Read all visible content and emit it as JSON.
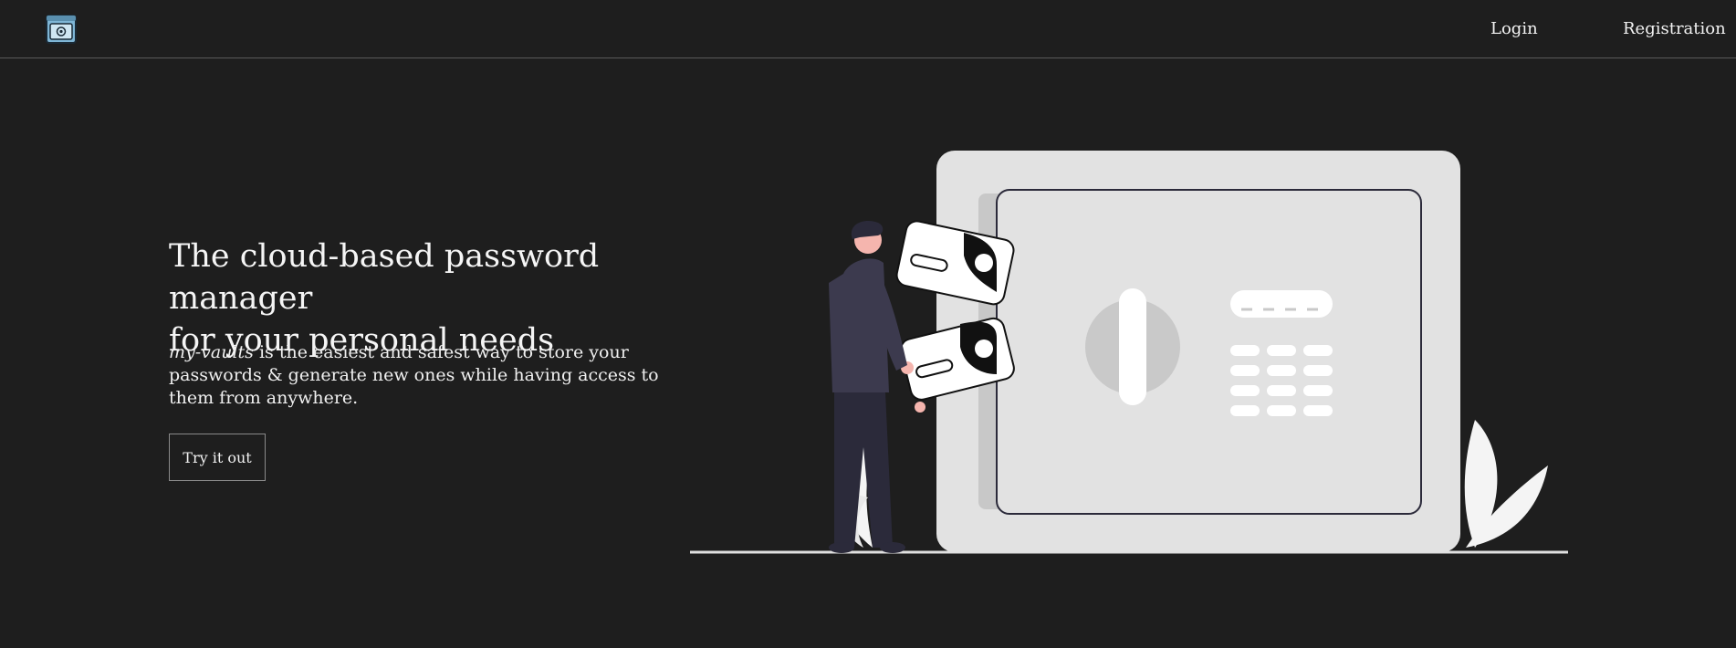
{
  "nav": {
    "links": [
      {
        "label": "Login"
      },
      {
        "label": "Registration"
      }
    ]
  },
  "hero": {
    "title_line1": "The cloud-based password manager",
    "title_line2": "for your personal needs",
    "brand": "my-vaults",
    "description": " is the easiest and safest way to store your passwords & generate new ones while having access to them from anywhere.",
    "cta_label": "Try it out"
  },
  "icons": {
    "logo": "vault-logo-icon",
    "illustration": "person-with-safe-illustration"
  },
  "colors": {
    "background": "#1e1e1e",
    "text": "#f2f2f2",
    "safe": "#e2e2e2",
    "figure": "#3c3a4e"
  }
}
